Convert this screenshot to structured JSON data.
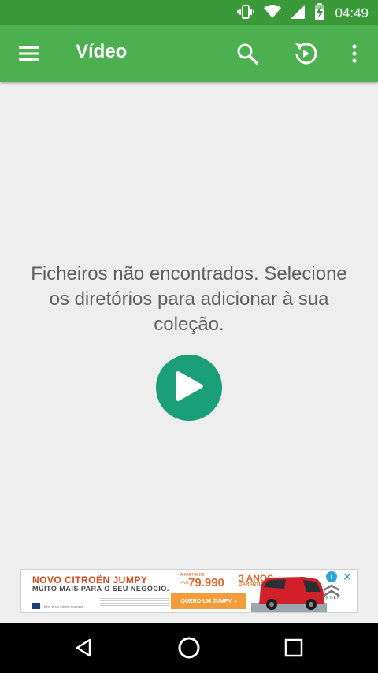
{
  "status_bar": {
    "time": "04:49",
    "icons": [
      "vibrate-icon",
      "wifi-icon",
      "signal-icon",
      "battery-charging-icon"
    ]
  },
  "app_bar": {
    "title": "Vídeo",
    "icons": [
      "menu-icon",
      "search-icon",
      "history-icon",
      "more-vert-icon"
    ],
    "color": "#4caf50",
    "status_color": "#3a9a3a"
  },
  "empty_state": {
    "message_line1": "Ficheiros não encontrados. Selecione",
    "message_line2": "os diretórios para adicionar à sua",
    "message_line3": "coleção.",
    "action_icon": "play-icon",
    "action_color": "#1a9f79"
  },
  "ad": {
    "title": "NOVO CITROËN JUMPY",
    "subtitle": "MUITO MAIS PARA O SEU NEGÓCIO.",
    "fine_print": "Bem vindo Citroën business",
    "price_from": "A PARTIR DE",
    "price_prefix": "+IVA",
    "price": "79.990",
    "years": "3 ANOS",
    "warranty": "GARANTIA",
    "cta_label": "QUERO UM JUMPY",
    "cta_arrow": "›",
    "brand": "CITROËN",
    "info_label": "i",
    "close_label": "✕"
  },
  "nav_bar": {
    "icons": [
      "back-icon",
      "home-icon",
      "recents-icon"
    ]
  }
}
